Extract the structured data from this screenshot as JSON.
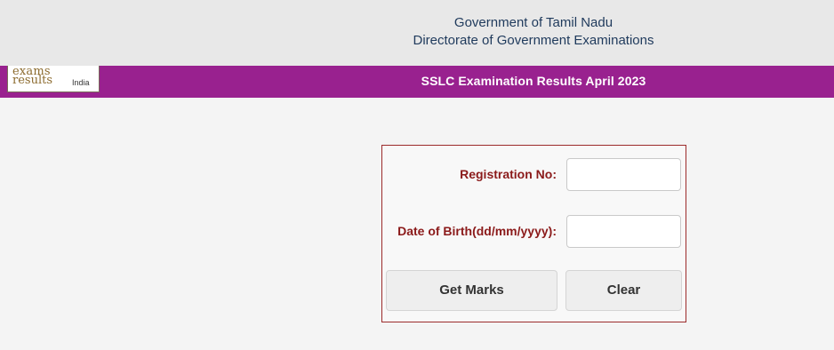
{
  "header": {
    "line1": "Government of Tamil Nadu",
    "line2": "Directorate of Government Examinations"
  },
  "banner": {
    "logo_word1": "exams",
    "logo_word2": "results",
    "logo_suffix": "India",
    "title": "SSLC  Examination Results  April 2023"
  },
  "form": {
    "registration_label": "Registration No:",
    "registration_value": "",
    "dob_label": "Date of Birth(dd/mm/yyyy):",
    "dob_value": "",
    "get_marks_label": "Get Marks",
    "clear_label": "Clear"
  },
  "colors": {
    "banner": "#99218f",
    "label": "#8b1a1a",
    "header_text": "#1f3a5c",
    "form_border": "#9c2b2b"
  }
}
